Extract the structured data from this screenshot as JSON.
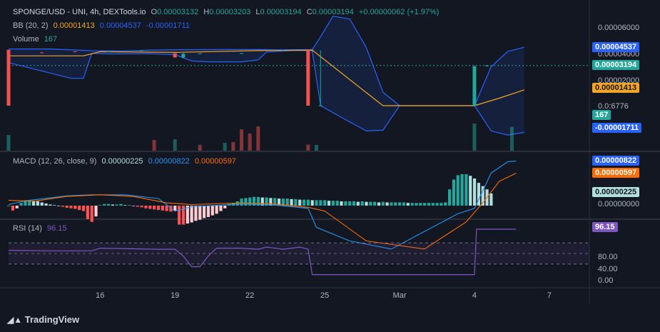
{
  "chart_data": {
    "type": "candlestick",
    "header": {
      "symbol": "SPONGE/USD - UNI, 4h, DEXTools.io",
      "o_label": "O",
      "o": "0.00003132",
      "h_label": "H",
      "h": "0.00003203",
      "l_label": "L",
      "l": "0.00003194",
      "c_label": "C",
      "c": "0.00003194",
      "change": "+0.00000062 (+1.97%)"
    },
    "bb": {
      "label": "BB (20, 2)",
      "basis": "0.00001413",
      "upper": "0.00004537",
      "lower": "-0.00001711"
    },
    "volume": {
      "label": "Volume",
      "value": "167"
    },
    "macd": {
      "label": "MACD (12, 26, close, 9)",
      "hist": "0.00000225",
      "macd": "0.00000822",
      "signal": "0.00000597"
    },
    "rsi": {
      "label": "RSI (14)",
      "value": "96.15"
    },
    "price_axis": {
      "ticks": [
        "0.00006000",
        "0.00004000",
        "0.00002000",
        "0.0:6776"
      ]
    },
    "price_tags": {
      "upper": "0.00004537",
      "close": "0.00003194",
      "basis": "0.00001413",
      "volume": "167",
      "lower": "-0.00001711"
    },
    "macd_axis": {
      "ticks": [
        "0.00000000"
      ]
    },
    "macd_tags": {
      "macd": "0.00000822",
      "signal": "0.00000597",
      "hist": "0.00000225"
    },
    "rsi_axis": {
      "ticks": [
        "80.00",
        "40.00",
        "0.00"
      ]
    },
    "rsi_tag": "96.15",
    "x_ticks": [
      {
        "label": "16",
        "t": 22
      },
      {
        "label": "19",
        "t": 40
      },
      {
        "label": "22",
        "t": 58
      },
      {
        "label": "25",
        "t": 76
      },
      {
        "label": "Mar",
        "t": 94
      },
      {
        "label": "4",
        "t": 112
      },
      {
        "label": "7",
        "t": 130
      }
    ],
    "candles": [
      {
        "t": 0,
        "o": 4.34e-05,
        "h": 4.34e-05,
        "l": 2.5e-06,
        "c": 2.5e-06
      },
      {
        "t": 8,
        "o": 4.15e-05,
        "h": 4.18e-05,
        "l": 4.13e-05,
        "c": 4.14e-05
      },
      {
        "t": 16,
        "o": 4.22e-05,
        "h": 4.23e-05,
        "l": 4.2e-05,
        "c": 4.21e-05
      },
      {
        "t": 24,
        "o": 4.24e-05,
        "h": 4.25e-05,
        "l": 4.23e-05,
        "c": 4.24e-05
      },
      {
        "t": 32,
        "o": 4.31e-05,
        "h": 4.32e-05,
        "l": 4.3e-05,
        "c": 4.31e-05
      },
      {
        "t": 40,
        "o": 4.08e-05,
        "h": 4.08e-05,
        "l": 3.78e-05,
        "c": 3.78e-05
      },
      {
        "t": 42,
        "o": 3.78e-05,
        "h": 4.1e-05,
        "l": 3.72e-05,
        "c": 4.05e-05
      },
      {
        "t": 46,
        "o": 4.08e-05,
        "h": 4.09e-05,
        "l": 4.07e-05,
        "c": 4.08e-05
      },
      {
        "t": 56,
        "o": 4.1e-05,
        "h": 4.11e-05,
        "l": 4.09e-05,
        "c": 4.1e-05
      },
      {
        "t": 66,
        "o": 4.28e-05,
        "h": 4.33e-05,
        "l": 4.25e-05,
        "c": 4.31e-05
      },
      {
        "t": 72,
        "o": 4.32e-05,
        "h": 4.32e-05,
        "l": 2.5e-06,
        "c": 2.5e-06
      },
      {
        "t": 75,
        "o": 2.7e-06,
        "h": 4.3e-05,
        "l": 2.5e-06,
        "c": 2.7e-06
      },
      {
        "t": 112,
        "o": 2.5e-06,
        "h": 3.21e-05,
        "l": 2.5e-06,
        "c": 3.13e-05
      },
      {
        "t": 115,
        "o": 3.13e-05,
        "h": 3.2e-05,
        "l": 3.12e-05,
        "c": 3.19e-05
      }
    ],
    "bb_upper": [
      [
        0,
        4.4e-05
      ],
      [
        10,
        4.4e-05
      ],
      [
        18,
        4.3e-05
      ],
      [
        20,
        4.27e-05
      ],
      [
        28,
        4.26e-05
      ],
      [
        34,
        4.32e-05
      ],
      [
        42,
        4.35e-05
      ],
      [
        52,
        4.36e-05
      ],
      [
        60,
        4.36e-05
      ],
      [
        64,
        4.34e-05
      ],
      [
        70,
        4.35e-05
      ],
      [
        73,
        4.35e-05
      ],
      [
        75,
        5.3e-05
      ],
      [
        78,
        6.8e-05
      ],
      [
        82,
        6.6e-05
      ],
      [
        86,
        4.5e-05
      ],
      [
        90,
        1.24e-05
      ],
      [
        94,
        2.5e-06
      ],
      [
        112,
        2.5e-06
      ],
      [
        116,
        3.1e-05
      ],
      [
        120,
        4.22e-05
      ],
      [
        124,
        4.53e-05
      ]
    ],
    "bb_basis": [
      [
        0,
        3.9e-05
      ],
      [
        18,
        3.9e-05
      ],
      [
        22,
        4.2e-05
      ],
      [
        40,
        4.15e-05
      ],
      [
        60,
        4.28e-05
      ],
      [
        73,
        4.32e-05
      ],
      [
        90,
        2.5e-06
      ],
      [
        112,
        2.5e-06
      ],
      [
        118,
        8e-06
      ],
      [
        124,
        1.41e-05
      ]
    ],
    "bb_lower": [
      [
        0,
        3.4e-05
      ],
      [
        15,
        2.25e-05
      ],
      [
        18,
        2.25e-05
      ],
      [
        20,
        4.08e-05
      ],
      [
        24,
        4.04e-05
      ],
      [
        34,
        4.05e-05
      ],
      [
        40,
        3.98e-05
      ],
      [
        44,
        3.52e-05
      ],
      [
        48,
        3.46e-05
      ],
      [
        56,
        3.46e-05
      ],
      [
        60,
        3.6e-05
      ],
      [
        62,
        4.18e-05
      ],
      [
        68,
        4.28e-05
      ],
      [
        73,
        4.28e-05
      ],
      [
        75,
        2.5e-06
      ],
      [
        80,
        -6e-06
      ],
      [
        86,
        -1.6e-05
      ],
      [
        90,
        -1.55e-05
      ],
      [
        94,
        2.5e-06
      ],
      [
        112,
        2.5e-06
      ],
      [
        116,
        -1.6e-05
      ],
      [
        120,
        -1.9e-05
      ],
      [
        124,
        -1.71e-05
      ]
    ],
    "volumes": [
      {
        "t": 0,
        "v": 110,
        "up": true
      },
      {
        "t": 35,
        "v": 75,
        "up": false
      },
      {
        "t": 40,
        "v": 80,
        "up": true
      },
      {
        "t": 46,
        "v": 40,
        "up": false
      },
      {
        "t": 52,
        "v": 55,
        "up": true
      },
      {
        "t": 54,
        "v": 60,
        "up": false
      },
      {
        "t": 56,
        "v": 150,
        "up": false
      },
      {
        "t": 58,
        "v": 120,
        "up": false
      },
      {
        "t": 60,
        "v": 170,
        "up": false
      },
      {
        "t": 72,
        "v": 42,
        "up": false
      },
      {
        "t": 74,
        "v": 40,
        "up": true
      },
      {
        "t": 112,
        "v": 190,
        "up": true
      },
      {
        "t": 121,
        "v": 167,
        "up": true
      }
    ],
    "macd_hist": [
      0,
      -0.9,
      -0.5,
      0.5,
      1.0,
      1.0,
      0.9,
      0.8,
      0.6,
      0.4,
      0.2,
      0.1,
      0.0,
      -0.2,
      -0.4,
      -0.5,
      -0.6,
      -0.8,
      -1.0,
      -2.5,
      -3.0,
      -2.0,
      0.1,
      0.3,
      0.3,
      0.2,
      0.2,
      0.3,
      0.1,
      0.1,
      0.0,
      -0.2,
      -0.3,
      -0.5,
      -0.6,
      -0.7,
      -0.8,
      -0.9,
      -1.0,
      -1.1,
      -1.0,
      -3.5,
      -3.5,
      -3.3,
      -3.1,
      -2.8,
      -2.6,
      -2.3,
      -2.1,
      -1.8,
      -1.5,
      -1.0,
      -0.5,
      0.3,
      0.5,
      0.8,
      1.3,
      1.4,
      1.5,
      1.6,
      1.6,
      1.5,
      1.5,
      1.4,
      1.4,
      1.3,
      1.3,
      1.3,
      1.2,
      1.2,
      1.1,
      1.1,
      1.1,
      1.0,
      1.0,
      1.0,
      1.0,
      0.9,
      0.9,
      0.9,
      0.8,
      0.8,
      0.8,
      0.8,
      0.7,
      0.8,
      0.7,
      0.7,
      0.7,
      0.6,
      0.7,
      0.6,
      0.6,
      0.6,
      0.6,
      0.6,
      0.5,
      0.5,
      0.5,
      0.5,
      0.5,
      0.5,
      0.5,
      0.5,
      0.5,
      0.6,
      3.0,
      4.8,
      5.6,
      5.8,
      5.8,
      5.5,
      5.0,
      4.2,
      3.6,
      3.0,
      2.25
    ],
    "macd_line": [
      [
        0,
        0.2
      ],
      [
        4,
        0.9
      ],
      [
        14,
        1.8
      ],
      [
        20,
        2.0
      ],
      [
        28,
        2.0
      ],
      [
        36,
        1.3
      ],
      [
        40,
        -1.0
      ],
      [
        44,
        -0.2
      ],
      [
        56,
        0.3
      ],
      [
        64,
        0.1
      ],
      [
        72,
        -0.5
      ],
      [
        74,
        -4.0
      ],
      [
        82,
        -6.5
      ],
      [
        92,
        -8
      ],
      [
        108,
        -1.5
      ],
      [
        112,
        -0.5
      ],
      [
        116,
        6.0
      ],
      [
        120,
        8.1
      ],
      [
        122,
        8.2
      ]
    ],
    "macd_signal": [
      [
        0,
        1.0
      ],
      [
        6,
        0.8
      ],
      [
        14,
        1.7
      ],
      [
        22,
        2.0
      ],
      [
        30,
        1.7
      ],
      [
        38,
        0.5
      ],
      [
        44,
        0.2
      ],
      [
        56,
        0.5
      ],
      [
        64,
        0.3
      ],
      [
        72,
        -0.3
      ],
      [
        76,
        -1.0
      ],
      [
        86,
        -6.5
      ],
      [
        100,
        -8
      ],
      [
        110,
        -3.0
      ],
      [
        114,
        0.5
      ],
      [
        118,
        4.5
      ],
      [
        122,
        5.97
      ]
    ],
    "rsi_line": [
      [
        0,
        56
      ],
      [
        10,
        55
      ],
      [
        20,
        55
      ],
      [
        22,
        60
      ],
      [
        36,
        58
      ],
      [
        40,
        58
      ],
      [
        42,
        45
      ],
      [
        44,
        25
      ],
      [
        46,
        25
      ],
      [
        48,
        45
      ],
      [
        50,
        60
      ],
      [
        56,
        60
      ],
      [
        60,
        58
      ],
      [
        62,
        62
      ],
      [
        66,
        58
      ],
      [
        70,
        62
      ],
      [
        72,
        58
      ],
      [
        73,
        10
      ],
      [
        76,
        10
      ],
      [
        100,
        10
      ],
      [
        112,
        10
      ],
      [
        112.5,
        96
      ],
      [
        122,
        96
      ]
    ]
  }
}
